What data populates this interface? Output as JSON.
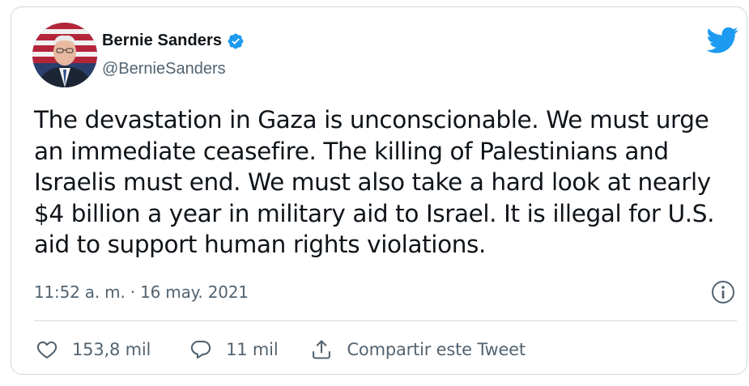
{
  "author": {
    "display_name": "Bernie Sanders",
    "handle": "@BernieSanders",
    "verified": true
  },
  "tweet": {
    "text": "The devastation in Gaza is unconscionable. We must urge an immediate ceasefire. The killing of Palestinians and Israelis must end. We must also take a hard look at nearly $4 billion a year in military aid to Israel. It is illegal for U.S. aid to support human rights violations.",
    "timestamp": "11:52 a. m. · 16 may. 2021"
  },
  "actions": {
    "likes": "153,8 mil",
    "replies": "11 mil",
    "share_label": "Compartir este Tweet"
  },
  "colors": {
    "brand_blue": "#1d9bf0",
    "muted_text": "#536471",
    "primary_text": "#0f1419",
    "border": "#cfd9de"
  },
  "icons": {
    "verified": "verified-badge-icon",
    "logo": "twitter-bird-icon",
    "info": "info-icon",
    "like": "heart-icon",
    "reply": "reply-bubble-icon",
    "share": "share-icon"
  }
}
